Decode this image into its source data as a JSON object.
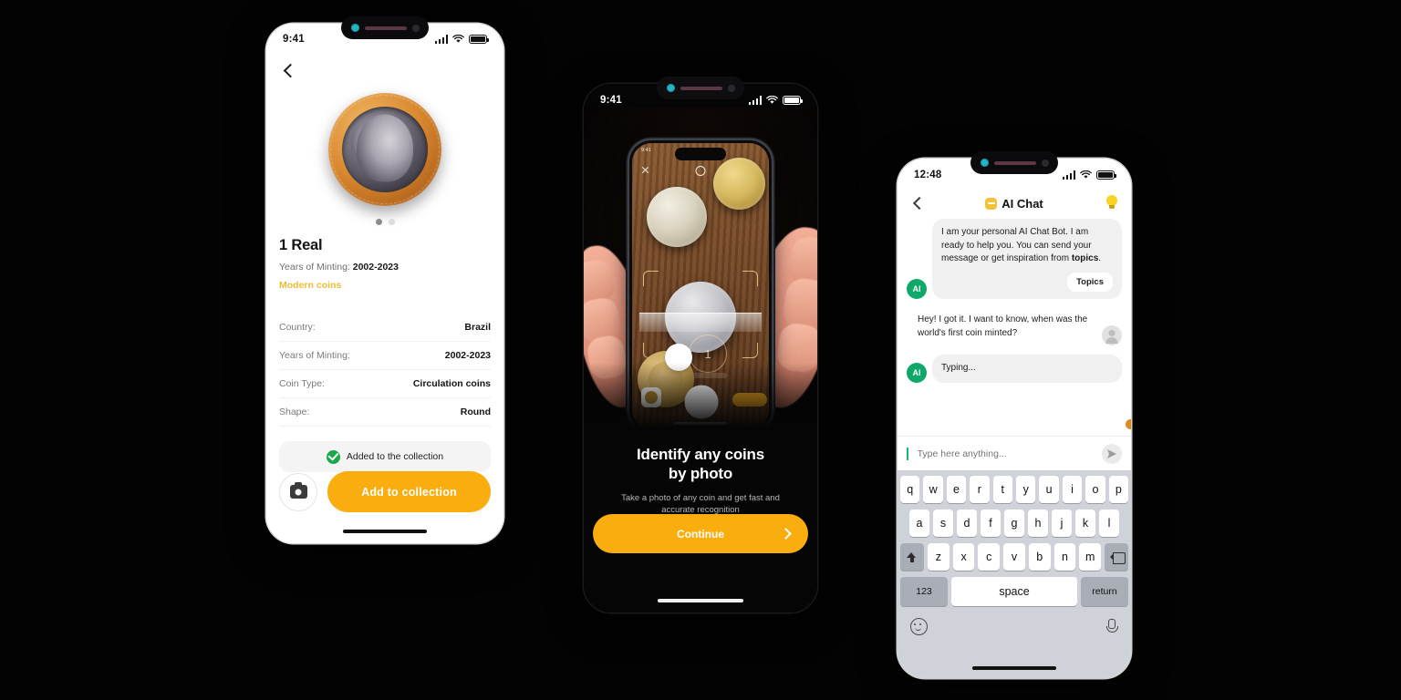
{
  "phone1": {
    "status": {
      "time": "9:41",
      "signal_icon": "cellular-bars-icon",
      "wifi_icon": "wifi-icon",
      "battery_icon": "battery-icon"
    },
    "back_icon": "chevron-left-icon",
    "coin_image_alt": "brazil-1-real-coin",
    "carousel": {
      "total": 2,
      "active": 1
    },
    "title": "1 Real",
    "subtitle_label": "Years of Minting:",
    "subtitle_value": "2002-2023",
    "category_tag": "Modern coins",
    "category_color": "#f0bc35",
    "specs": [
      {
        "label": "Country:",
        "value": "Brazil"
      },
      {
        "label": "Years of Minting:",
        "value": "2002-2023"
      },
      {
        "label": "Coin Type:",
        "value": "Circulation coins"
      },
      {
        "label": "Shape:",
        "value": "Round"
      }
    ],
    "added_banner": "Added to the collection",
    "added_icon": "check-circle-icon",
    "camera_icon": "camera-icon",
    "cta_label": "Add to collection",
    "cta_color": "#f9ad0e"
  },
  "phone2": {
    "status": {
      "time": "9:41",
      "signal_icon": "cellular-bars-icon",
      "wifi_icon": "wifi-icon",
      "battery_icon": "battery-icon"
    },
    "hero_alt": "hand-holding-phone-scanning-coins-on-wood",
    "inner": {
      "time": "9:41",
      "close_icon": "close-x-icon",
      "flash_icon": "flash-circle-icon",
      "coin_count_label": "1"
    },
    "headline_line1": "Identify any coins",
    "headline_line2": "by photo",
    "body": "Take a photo of any coin and get fast and accurate recognition",
    "cta_label": "Continue",
    "cta_icon": "chevron-right-icon",
    "cta_color": "#f9ad0e"
  },
  "phone3": {
    "status": {
      "time": "12:48",
      "signal_icon": "cellular-bars-icon",
      "wifi_icon": "wifi-icon",
      "battery_icon": "battery-icon"
    },
    "back_icon": "chevron-left-icon",
    "title": "AI Chat",
    "title_emoji_icon": "robot-emoji-icon",
    "hint_icon": "lightbulb-icon",
    "messages": [
      {
        "from": "ai",
        "avatar": "AI",
        "text": "I am your personal AI Chat Bot. I am ready to help you. You can send your message or get inspiration from ",
        "bold_tail": "topics",
        "tail": ".",
        "action": "Topics"
      },
      {
        "from": "user",
        "avatar": "user-avatar-icon",
        "text": "Hey! I got it. I want to know, when was the world's first coin minted?"
      },
      {
        "from": "ai",
        "avatar": "AI",
        "text": "Typing..."
      }
    ],
    "input_placeholder": "Type here anything...",
    "send_icon": "send-arrow-icon",
    "keyboard": {
      "row1": [
        "q",
        "w",
        "e",
        "r",
        "t",
        "y",
        "u",
        "i",
        "o",
        "p"
      ],
      "row2": [
        "a",
        "s",
        "d",
        "f",
        "g",
        "h",
        "j",
        "k",
        "l"
      ],
      "row3": [
        "z",
        "x",
        "c",
        "v",
        "b",
        "n",
        "m"
      ],
      "shift_icon": "shift-icon",
      "delete_icon": "backspace-icon",
      "numbers_key": "123",
      "space_key": "space",
      "return_key": "return",
      "emoji_icon": "emoji-smiley-icon",
      "mic_icon": "microphone-icon"
    }
  }
}
